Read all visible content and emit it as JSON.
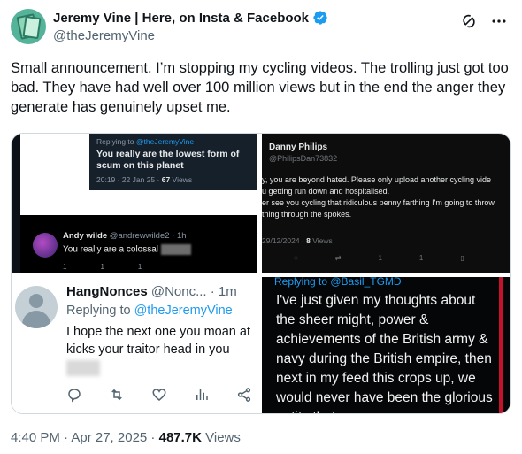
{
  "author": {
    "display_name": "Jeremy Vine | Here, on Insta & Facebook",
    "handle": "@theJeremyVine"
  },
  "tweet": {
    "text": "Small announcement. I’m stopping my cycling videos. The trolling just got too bad. They have had well over 100 million views but in the end the anger they generate has genuinely upset me.",
    "timestamp": "4:40 PM · Apr 27, 2025",
    "views_count": "487.7K",
    "views_label": " Views"
  },
  "media": {
    "q1": {
      "reply_prefix": "Replying to ",
      "reply_to": "@theJeremyVine",
      "reply_text": "You really are the lowest form of scum on this planet",
      "meta_time": "20:19 · 22 Jan 25 · ",
      "meta_views": "67",
      "meta_views_label": " Views",
      "lower_name": "Andy wilde",
      "lower_handle": " @andrewwilde2 · 1h",
      "lower_text": "You really are a colossal",
      "counts": [
        "1",
        "1",
        "1"
      ]
    },
    "q2": {
      "name": "Danny Philips",
      "handle": "@PhilipsDan73832",
      "lines": [
        "y, you are beyond hated. Please only upload another cycling vide",
        "u getting run down and hospitalised.",
        "er see you cycling that ridiculous penny farthing I'm going to throw",
        "thing through the spokes."
      ],
      "meta_date": "29/12/2024 · ",
      "meta_views": "8",
      "meta_views_label": " Views",
      "counts": [
        "1",
        "1"
      ]
    },
    "q3": {
      "name": "HangNonces",
      "handle": " @Nonc... · 1m",
      "reply_prefix": "Replying to ",
      "reply_to": "@theJeremyVine",
      "text": "I hope the next one you moan at kicks your traitor head in you"
    },
    "q4": {
      "reply_prefix": "Replying to ",
      "reply_to": "@Basil_TGMD",
      "text": "I've just given my thoughts about the sheer might, power & achievements of the British army & navy during the British empire, then next in my feed this crops up, we would never have been the glorious entity that we are now,"
    }
  },
  "icons": {
    "verified": "verified-badge-icon",
    "grok": "grok-icon",
    "more": "more-icon",
    "reply": "reply-icon",
    "retweet": "retweet-icon",
    "like": "like-icon",
    "views": "views-icon",
    "share": "share-icon"
  },
  "colors": {
    "accent": "#1d9bf0",
    "text": "#0f1419",
    "secondary": "#536471"
  }
}
